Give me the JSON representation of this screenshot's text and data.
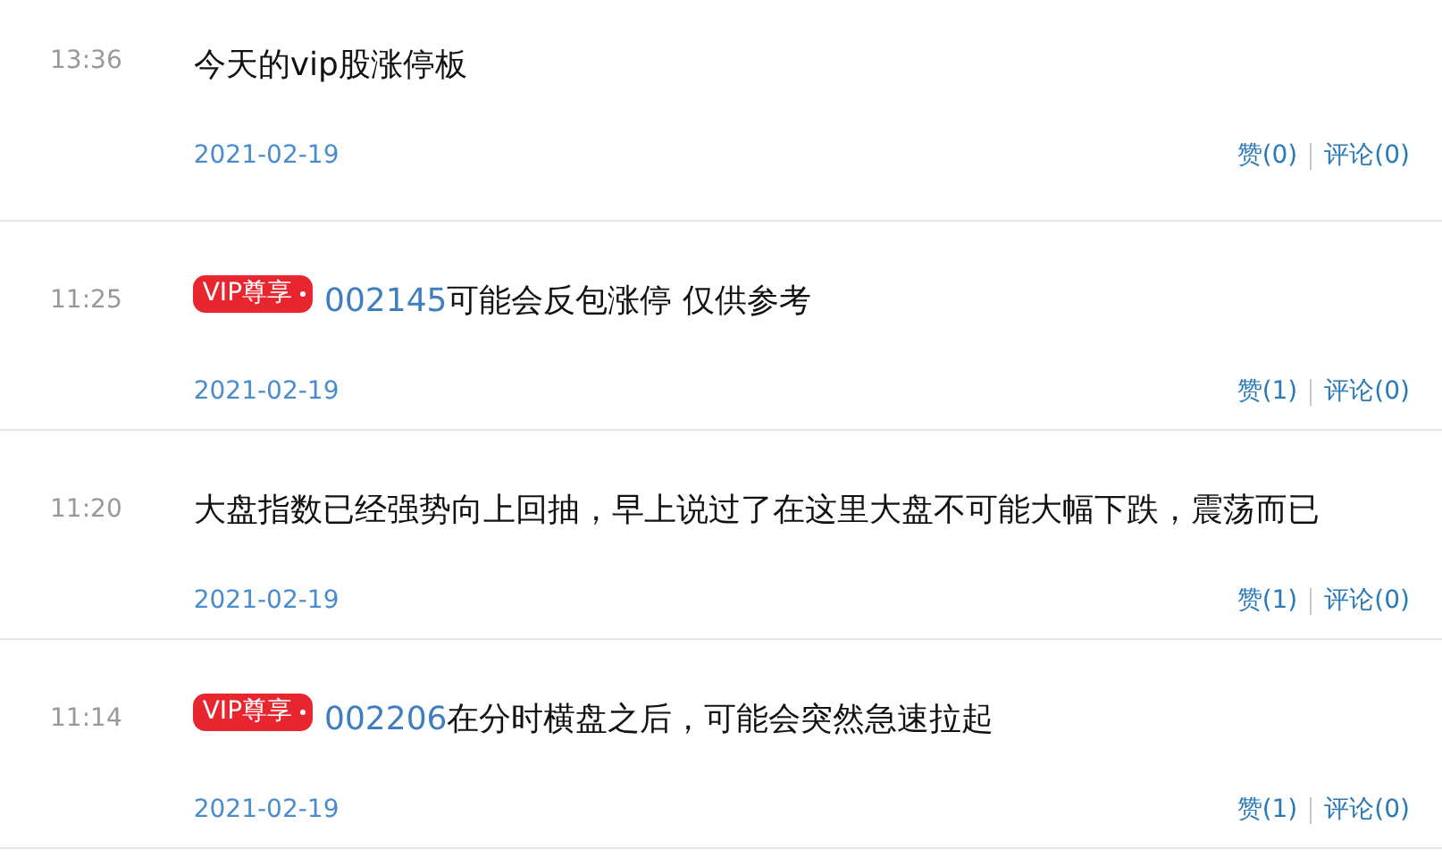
{
  "posts": [
    {
      "kind": "plain",
      "time": "13:36",
      "text": "今天的vip股涨停板",
      "date": "2021-02-19",
      "likes": "赞(0)",
      "comments": "评论(0)"
    },
    {
      "kind": "vip",
      "time": "11:25",
      "badge": "VIP尊享",
      "code": "002145",
      "text": "可能会反包涨停 仅供参考",
      "date": "2021-02-19",
      "likes": "赞(1)",
      "comments": "评论(0)"
    },
    {
      "kind": "plain",
      "time": "11:20",
      "text": "大盘指数已经强势向上回抽，早上说过了在这里大盘不可能大幅下跌，震荡而已",
      "date": "2021-02-19",
      "likes": "赞(1)",
      "comments": "评论(0)"
    },
    {
      "kind": "vip",
      "time": "11:14",
      "badge": "VIP尊享",
      "code": "002206",
      "text": "在分时横盘之后，可能会突然急速拉起",
      "date": "2021-02-19",
      "likes": "赞(1)",
      "comments": "评论(0)"
    }
  ]
}
